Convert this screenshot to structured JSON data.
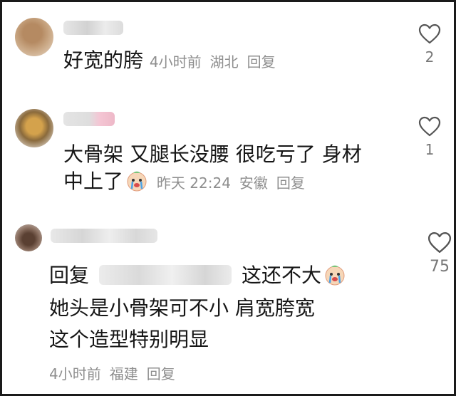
{
  "comments": [
    {
      "text_line1": "好宽的胯",
      "meta": {
        "time": "4小时前",
        "location": "湖北",
        "reply": "回复"
      },
      "likes": "2"
    },
    {
      "text_line1": "大骨架  又腿长没腰  很吃亏了  身材",
      "text_line2": "中上了",
      "meta": {
        "time": "昨天 22:24",
        "location": "安徽",
        "reply": "回复"
      },
      "likes": "1"
    },
    {
      "reply_prefix": "回复",
      "text_line1_suffix": "这还不大",
      "text_line2": "她头是小骨架可不小 肩宽胯宽",
      "text_line3": "这个造型特别明显",
      "meta": {
        "time": "4小时前",
        "location": "福建",
        "reply": "回复"
      },
      "likes": "75"
    }
  ],
  "icons": {
    "like": "heart-outline-icon",
    "emoji": "crying-face-emoji"
  },
  "colors": {
    "text": "#161616",
    "meta": "#8e8e8e",
    "count": "#777777",
    "border": "#1a1a1a"
  }
}
